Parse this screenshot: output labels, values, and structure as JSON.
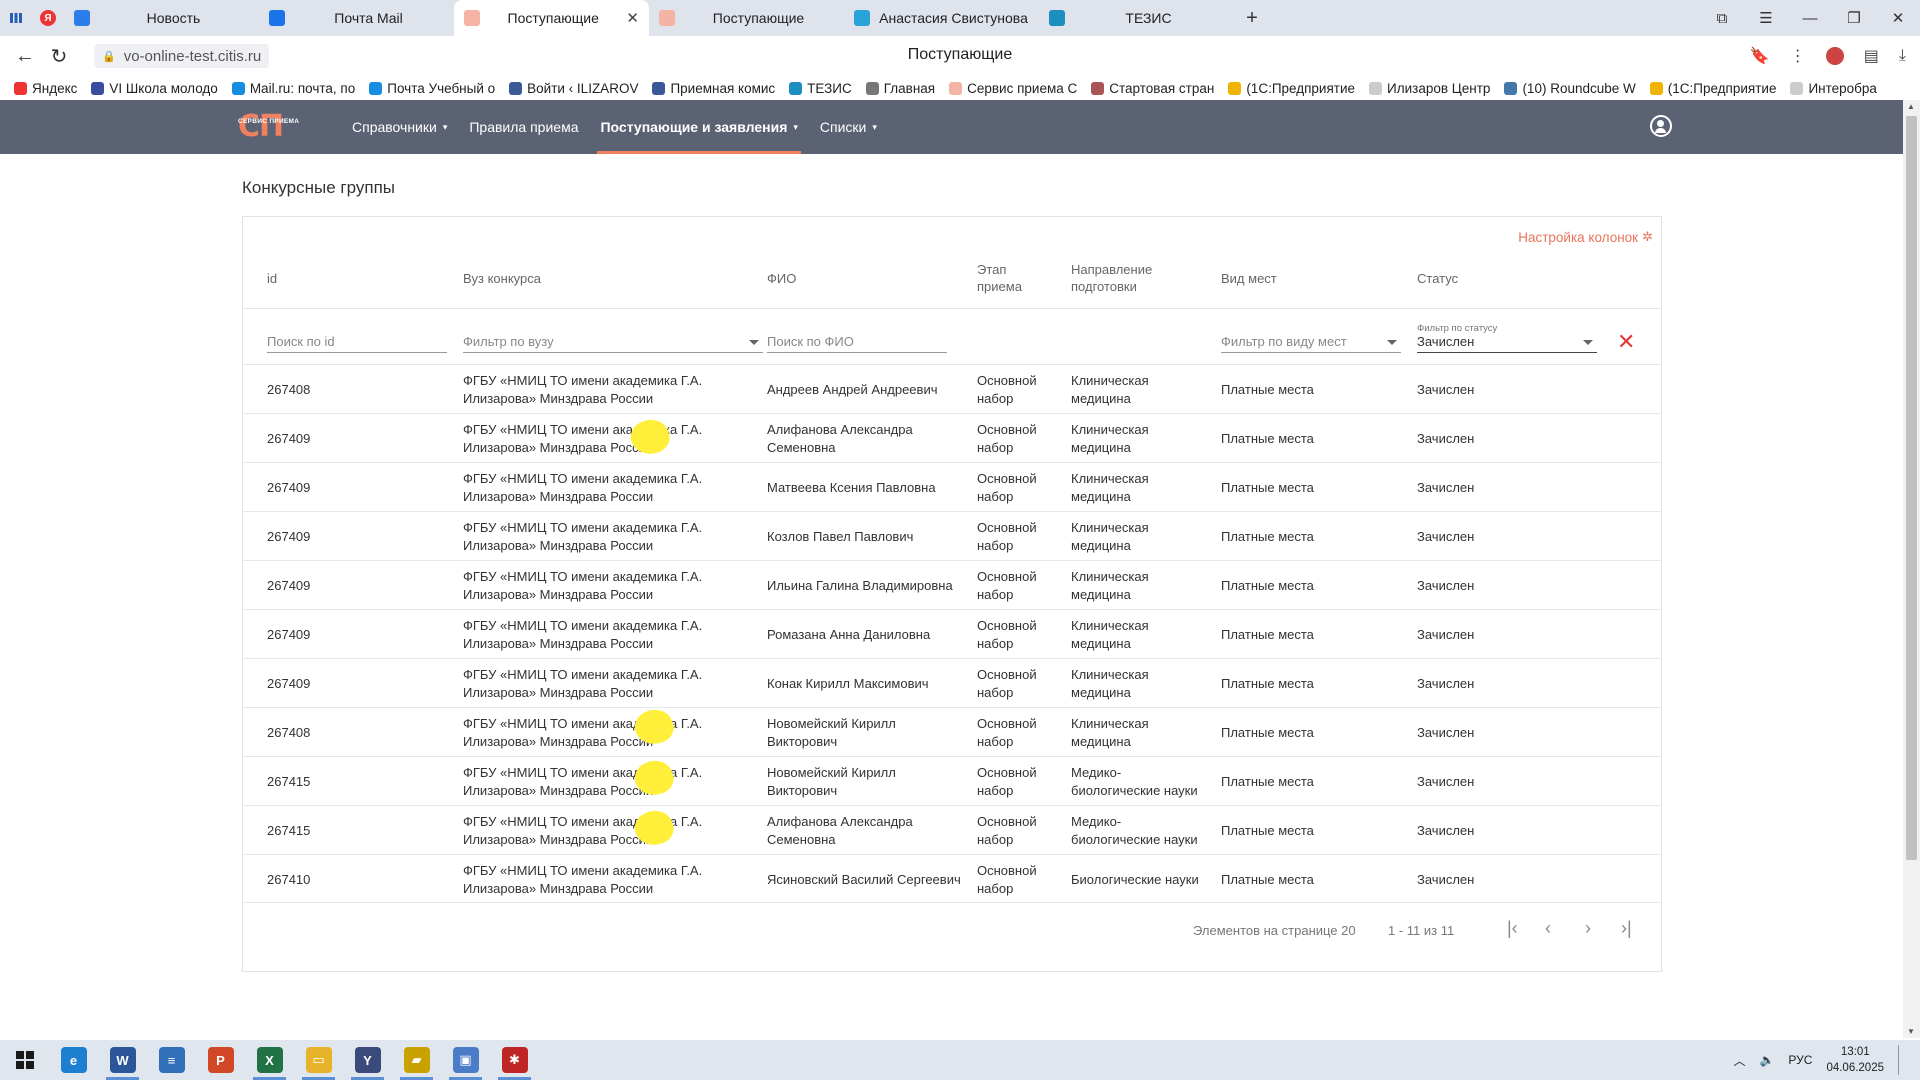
{
  "browser": {
    "tabs": [
      {
        "title": "Новость",
        "color": "#2b7de9",
        "active": false
      },
      {
        "title": "Почта Mail",
        "color": "#1a73e8",
        "active": false
      },
      {
        "title": "Поступающие",
        "color": "#f3b4a5",
        "active": true
      },
      {
        "title": "Поступающие",
        "color": "#f3b4a5",
        "active": false
      },
      {
        "title": "Анастасия Свистунова",
        "color": "#2aa3d9",
        "active": false
      },
      {
        "title": "ТЕЗИС",
        "color": "#1b8fbf",
        "active": false
      }
    ],
    "url": "vo-online-test.citis.ru",
    "page_title": "Поступающие",
    "bookmarks": [
      {
        "label": "Яндекс",
        "color": "#e33"
      },
      {
        "label": "VI Школа молодо",
        "color": "#3b4da0"
      },
      {
        "label": "Mail.ru: почта, по",
        "color": "#168de2"
      },
      {
        "label": "Почта Учебный о",
        "color": "#168de2"
      },
      {
        "label": "Войти ‹ ILIZAROV",
        "color": "#3b5998"
      },
      {
        "label": "Приемная комис",
        "color": "#3b5998"
      },
      {
        "label": "ТЕЗИС",
        "color": "#1b8fbf"
      },
      {
        "label": "Главная",
        "color": "#777"
      },
      {
        "label": "Сервис приема С",
        "color": "#f3b4a5"
      },
      {
        "label": "Стартовая стран",
        "color": "#a55"
      },
      {
        "label": "(1С:Предприятие",
        "color": "#f0b400"
      },
      {
        "label": "Илизаров Центр",
        "color": "#ccc"
      },
      {
        "label": "(10) Roundcube W",
        "color": "#4477aa"
      },
      {
        "label": "(1С:Предприятие",
        "color": "#f0b400"
      },
      {
        "label": "Интеробра",
        "color": "#ccc"
      }
    ]
  },
  "app": {
    "logo_sub": "СЕРВИС ПРИЕМА",
    "logo_main": "СП",
    "nav": [
      {
        "label": "Справочники",
        "dropdown": true,
        "active": false
      },
      {
        "label": "Правила приема",
        "dropdown": false,
        "active": false
      },
      {
        "label": "Поступающие и заявления",
        "dropdown": true,
        "active": true
      },
      {
        "label": "Списки",
        "dropdown": true,
        "active": false
      }
    ],
    "accent": "#ef8060",
    "header_bg": "#5b6273"
  },
  "main": {
    "section_title": "Конкурсные группы",
    "columns_settings": "Настройка колонок",
    "columns": {
      "id": "id",
      "vuz": "Вуз конкурса",
      "fio": "ФИО",
      "etap_1": "Этап",
      "etap_2": "приема",
      "napr_1": "Направление",
      "napr_2": "подготовки",
      "vid": "Вид мест",
      "status": "Статус"
    },
    "filters": {
      "id_placeholder": "Поиск по id",
      "vuz_placeholder": "Фильтр по вузу",
      "fio_placeholder": "Поиск по ФИО",
      "vid_placeholder": "Фильтр по виду мест",
      "status_label": "Фильтр по статусу",
      "status_value": "Зачислен"
    },
    "rows": [
      {
        "id": "267408",
        "vuz1": "ФГБУ «НМИЦ ТО имени академика Г.А.",
        "vuz2": "Илизарова» Минздрава России",
        "fio1": "Андреев Андрей Андреевич",
        "fio2": "",
        "etap1": "Основной",
        "etap2": "набор",
        "napr1": "Клиническая",
        "napr2": "медицина",
        "vid": "Платные места",
        "status": "Зачислен",
        "mark": false
      },
      {
        "id": "267409",
        "vuz1": "ФГБУ «НМИЦ ТО имени академика Г.А.",
        "vuz2": "Илизарова» Минздрава России",
        "fio1": "Алифанова Александра",
        "fio2": "Семеновна",
        "etap1": "Основной",
        "etap2": "набор",
        "napr1": "Клиническая",
        "napr2": "медицина",
        "vid": "Платные места",
        "status": "Зачислен",
        "mark": true
      },
      {
        "id": "267409",
        "vuz1": "ФГБУ «НМИЦ ТО имени академика Г.А.",
        "vuz2": "Илизарова» Минздрава России",
        "fio1": "Матвеева Ксения Павловна",
        "fio2": "",
        "etap1": "Основной",
        "etap2": "набор",
        "napr1": "Клиническая",
        "napr2": "медицина",
        "vid": "Платные места",
        "status": "Зачислен",
        "mark": false
      },
      {
        "id": "267409",
        "vuz1": "ФГБУ «НМИЦ ТО имени академика Г.А.",
        "vuz2": "Илизарова» Минздрава России",
        "fio1": "Козлов Павел Павлович",
        "fio2": "",
        "etap1": "Основной",
        "etap2": "набор",
        "napr1": "Клиническая",
        "napr2": "медицина",
        "vid": "Платные места",
        "status": "Зачислен",
        "mark": false
      },
      {
        "id": "267409",
        "vuz1": "ФГБУ «НМИЦ ТО имени академика Г.А.",
        "vuz2": "Илизарова» Минздрава России",
        "fio1": "Ильина Галина Владимировна",
        "fio2": "",
        "etap1": "Основной",
        "etap2": "набор",
        "napr1": "Клиническая",
        "napr2": "медицина",
        "vid": "Платные места",
        "status": "Зачислен",
        "mark": false
      },
      {
        "id": "267409",
        "vuz1": "ФГБУ «НМИЦ ТО имени академика Г.А.",
        "vuz2": "Илизарова» Минздрава России",
        "fio1": "Ромазана Анна Даниловна",
        "fio2": "",
        "etap1": "Основной",
        "etap2": "набор",
        "napr1": "Клиническая",
        "napr2": "медицина",
        "vid": "Платные места",
        "status": "Зачислен",
        "mark": false
      },
      {
        "id": "267409",
        "vuz1": "ФГБУ «НМИЦ ТО имени академика Г.А.",
        "vuz2": "Илизарова» Минздрава России",
        "fio1": "Конак Кирилл Максимович",
        "fio2": "",
        "etap1": "Основной",
        "etap2": "набор",
        "napr1": "Клиническая",
        "napr2": "медицина",
        "vid": "Платные места",
        "status": "Зачислен",
        "mark": false
      },
      {
        "id": "267408",
        "vuz1": "ФГБУ «НМИЦ ТО имени академика Г.А.",
        "vuz2": "Илизарова» Минздрава России",
        "fio1": "Новомейский Кирилл",
        "fio2": "Викторович",
        "etap1": "Основной",
        "etap2": "набор",
        "napr1": "Клиническая",
        "napr2": "медицина",
        "vid": "Платные места",
        "status": "Зачислен",
        "mark": true
      },
      {
        "id": "267415",
        "vuz1": "ФГБУ «НМИЦ ТО имени академика Г.А.",
        "vuz2": "Илизарова» Минздрава России",
        "fio1": "Новомейский Кирилл",
        "fio2": "Викторович",
        "etap1": "Основной",
        "etap2": "набор",
        "napr1": "Медико-",
        "napr2": "биологические науки",
        "vid": "Платные места",
        "status": "Зачислен",
        "mark": true
      },
      {
        "id": "267415",
        "vuz1": "ФГБУ «НМИЦ ТО имени академика Г.А.",
        "vuz2": "Илизарова» Минздрава России",
        "fio1": "Алифанова Александра",
        "fio2": "Семеновна",
        "etap1": "Основной",
        "etap2": "набор",
        "napr1": "Медико-",
        "napr2": "биологические науки",
        "vid": "Платные места",
        "status": "Зачислен",
        "mark": true
      },
      {
        "id": "267410",
        "vuz1": "ФГБУ «НМИЦ ТО имени академика Г.А.",
        "vuz2": "Илизарова» Минздрава России",
        "fio1": "Ясиновский Василий Сергеевич",
        "fio2": "",
        "etap1": "Основной",
        "etap2": "набор",
        "napr1": "Биологические науки",
        "napr2": "",
        "vid": "Платные места",
        "status": "Зачислен",
        "mark": false
      }
    ],
    "pager": {
      "items_per_page_label": "Элементов на странице",
      "items_per_page": "20",
      "range": "1 - 11 из 11"
    }
  },
  "taskbar": {
    "apps": [
      {
        "name": "edge",
        "color": "#1d7fd0",
        "glyph": "e"
      },
      {
        "name": "word",
        "color": "#2b579a",
        "glyph": "W"
      },
      {
        "name": "app3",
        "color": "#3070b8",
        "glyph": "≡"
      },
      {
        "name": "powerpoint",
        "color": "#d24726",
        "glyph": "P"
      },
      {
        "name": "excel",
        "color": "#217346",
        "glyph": "X"
      },
      {
        "name": "explorer",
        "color": "#e8b32b",
        "glyph": "▭"
      },
      {
        "name": "yandex",
        "color": "#3a4a7a",
        "glyph": "Y"
      },
      {
        "name": "app8",
        "color": "#c9a100",
        "glyph": "▰"
      },
      {
        "name": "app9",
        "color": "#4a7cc7",
        "glyph": "▣"
      },
      {
        "name": "app10",
        "color": "#c02525",
        "glyph": "✱"
      }
    ],
    "lang": "РУС",
    "time": "13:01",
    "date": "04.06.2025"
  }
}
